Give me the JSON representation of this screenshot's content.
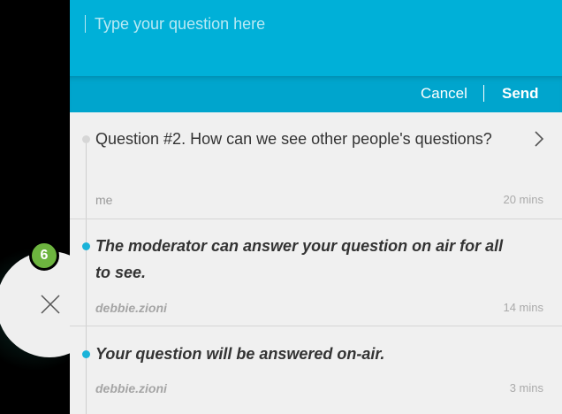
{
  "composer": {
    "placeholder": "Type your question here",
    "cancel_label": "Cancel",
    "send_label": "Send"
  },
  "badge": {
    "count": "6"
  },
  "feed": {
    "question": {
      "text": "Question #2.  How can we see other people's questions?",
      "author": "me",
      "time": "20 mins"
    },
    "answers": [
      {
        "text": "The moderator can answer your question on air for all to see.",
        "author": "debbie.zioni",
        "time": "14 mins"
      },
      {
        "text": "Your question will be answered on-air.",
        "author": "debbie.zioni",
        "time": "3 mins"
      }
    ]
  },
  "colors": {
    "composer_bg": "#00b0d8",
    "actions_bg": "#00a5cd",
    "answer_dot": "#1ab3d9",
    "badge": "#6db43f"
  },
  "icons": [
    "close-icon",
    "chevron-right-icon"
  ]
}
